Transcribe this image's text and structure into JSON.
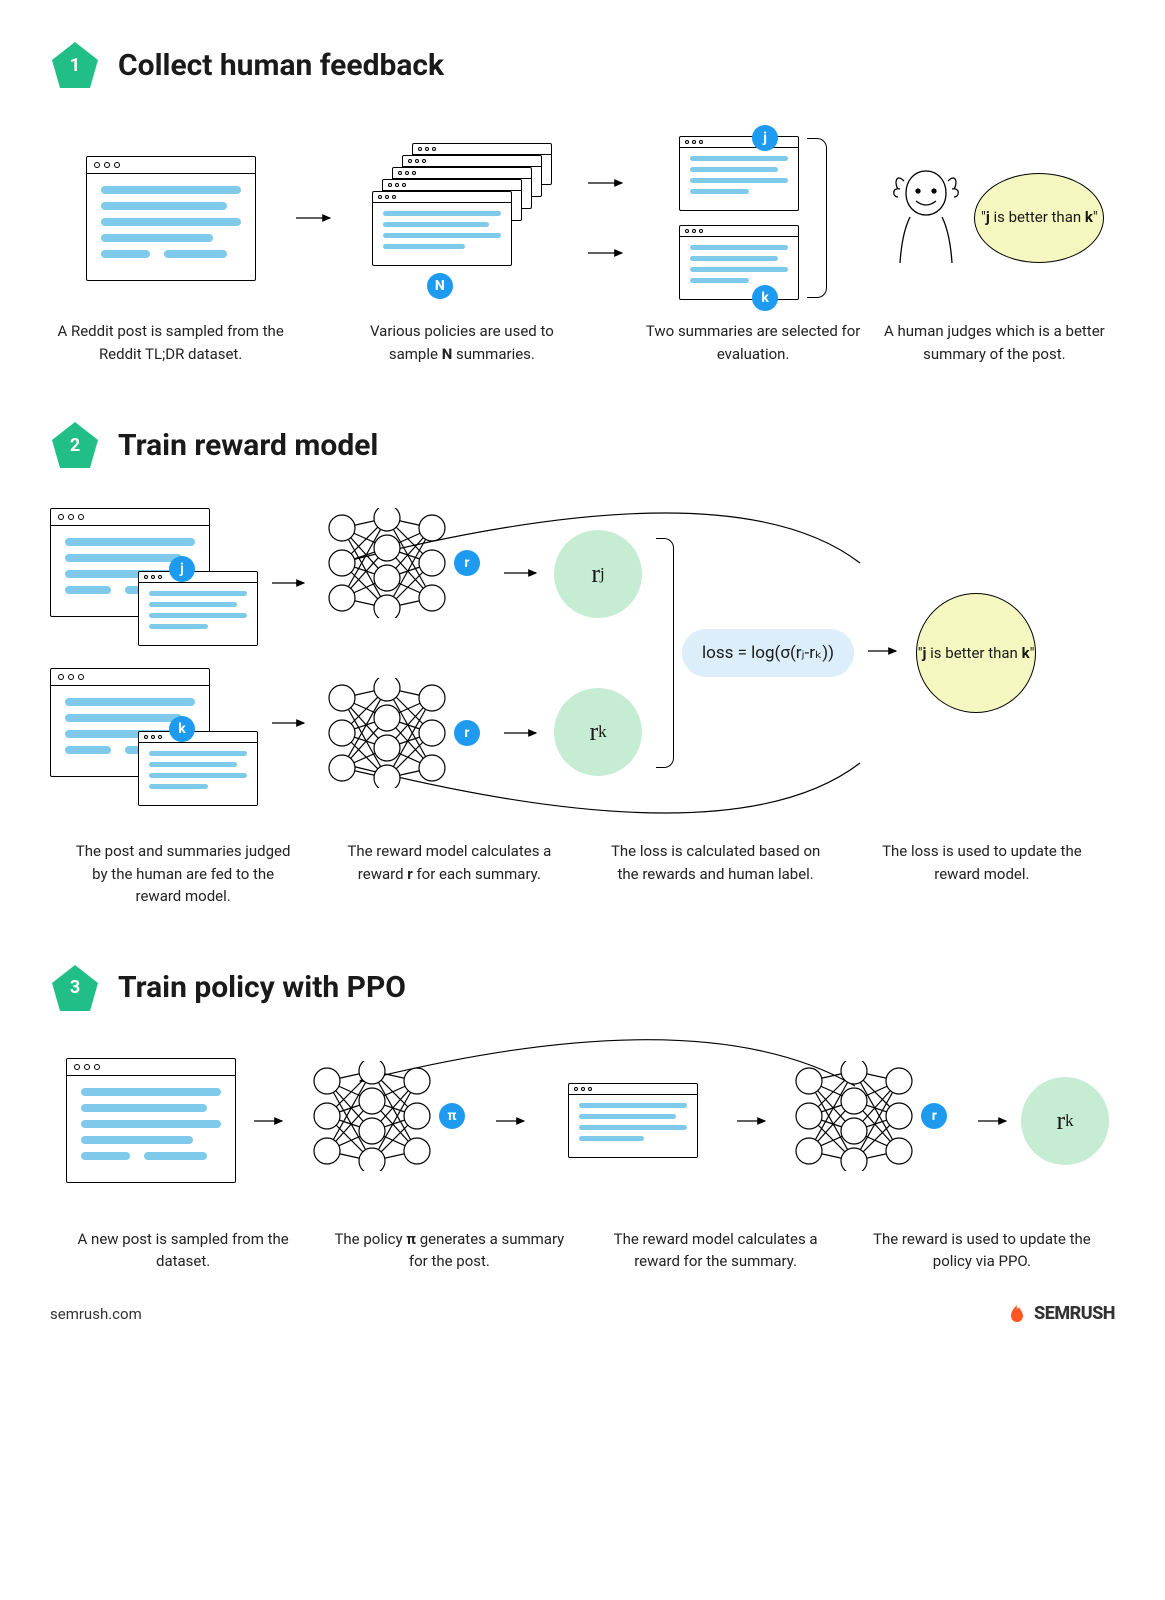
{
  "sections": [
    {
      "num": "1",
      "title": "Collect human feedback",
      "steps": [
        "A Reddit post is sampled from the Reddit TL;DR dataset.",
        "Various policies are used to sample N summaries.",
        "Two summaries are selected for evaluation.",
        "A human judges which is a better summary of the post."
      ]
    },
    {
      "num": "2",
      "title": "Train reward model",
      "steps": [
        "The post and summaries judged by the human are fed to the reward model.",
        "The reward model calculates a reward r for each summary.",
        "The loss is calculated based on the rewards and human label.",
        "The loss is used to update the reward model."
      ]
    },
    {
      "num": "3",
      "title": "Train policy with PPO",
      "steps": [
        "A new post is sampled from the dataset.",
        "The policy π generates a summary for the post.",
        "The reward model calculates a reward for the summary.",
        "The reward is used to update the policy via PPO."
      ]
    }
  ],
  "labels": {
    "N": "N",
    "j": "j",
    "k": "k",
    "r": "r",
    "pi": "π",
    "rj": "rⱼ",
    "rk": "rₖ",
    "loss_formula": "loss = log(σ(rⱼ-rₖ))",
    "verdict_prefix": "\"",
    "verdict_j": "j",
    "verdict_mid": " is better than ",
    "verdict_k": "k",
    "verdict_suffix": "\"",
    "footer_url": "semrush.com",
    "brand": "SEMRUSH"
  },
  "colors": {
    "accent": "#21bf87",
    "blue": "#1e9bf0",
    "line": "#7fc9ea"
  }
}
